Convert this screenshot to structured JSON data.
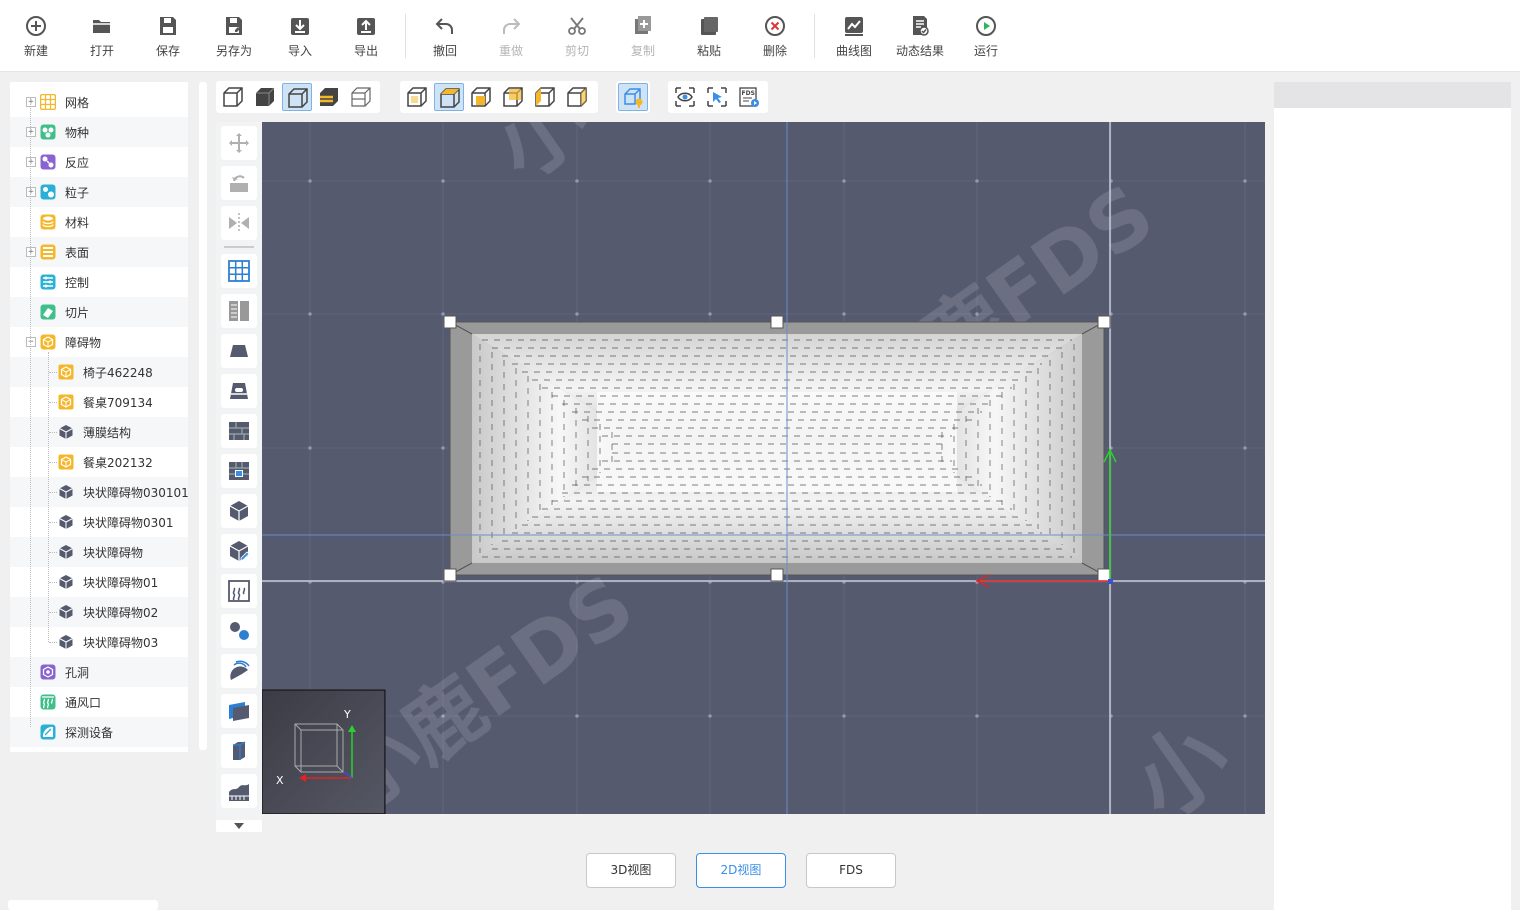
{
  "toolbar": {
    "new": "新建",
    "open": "打开",
    "save": "保存",
    "save_as": "另存为",
    "import": "导入",
    "export": "导出",
    "undo": "撤回",
    "redo": "重做",
    "cut": "剪切",
    "copy": "复制",
    "paste": "粘贴",
    "delete": "删除",
    "curve": "曲线图",
    "dynamic_result": "动态结果",
    "run": "运行"
  },
  "tree": {
    "items": [
      {
        "label": "网格",
        "icon": "grid-icon",
        "color": "#f5b72a",
        "expandable": true
      },
      {
        "label": "物种",
        "icon": "species-icon",
        "color": "#3fbf8a",
        "expandable": true
      },
      {
        "label": "反应",
        "icon": "reaction-icon",
        "color": "#8a63d2",
        "expandable": true
      },
      {
        "label": "粒子",
        "icon": "particle-icon",
        "color": "#2ab0d6",
        "expandable": true
      },
      {
        "label": "材料",
        "icon": "material-icon",
        "color": "#f5b72a",
        "expandable": false
      },
      {
        "label": "表面",
        "icon": "surface-icon",
        "color": "#f5b72a",
        "expandable": true
      },
      {
        "label": "控制",
        "icon": "control-icon",
        "color": "#2ab0d6",
        "expandable": false
      },
      {
        "label": "切片",
        "icon": "slice-icon",
        "color": "#3fbf8a",
        "expandable": false
      },
      {
        "label": "障碍物",
        "icon": "obstruction-icon",
        "color": "#f5b72a",
        "expandable": true,
        "expanded": true
      },
      {
        "label": "孔洞",
        "icon": "hole-icon",
        "color": "#8a63d2",
        "expandable": false
      },
      {
        "label": "通风口",
        "icon": "vent-icon",
        "color": "#3fbf8a",
        "expandable": false
      },
      {
        "label": "探测设备",
        "icon": "device-icon",
        "color": "#2ab0d6",
        "expandable": false
      }
    ],
    "obstructions": [
      {
        "label": "椅子462248",
        "icon": "furniture-icon"
      },
      {
        "label": "餐桌709134",
        "icon": "furniture-icon"
      },
      {
        "label": "薄膜结构",
        "icon": "block-icon"
      },
      {
        "label": "餐桌202132",
        "icon": "furniture-icon"
      },
      {
        "label": "块状障碍物030101",
        "icon": "block-icon"
      },
      {
        "label": "块状障碍物0301",
        "icon": "block-icon"
      },
      {
        "label": "块状障碍物",
        "icon": "block-icon"
      },
      {
        "label": "块状障碍物01",
        "icon": "block-icon"
      },
      {
        "label": "块状障碍物02",
        "icon": "block-icon"
      },
      {
        "label": "块状障碍物03",
        "icon": "block-icon"
      }
    ]
  },
  "viewport": {
    "axis_x": "X",
    "axis_y": "Y",
    "background": "#555a6f"
  },
  "views": {
    "view3d": "3D视图",
    "view2d": "2D视图",
    "fds": "FDS",
    "active": "2D视图"
  },
  "colors": {
    "accent": "#3a8ee6",
    "furniture": "#f5b72a",
    "block": "#555a6f"
  }
}
